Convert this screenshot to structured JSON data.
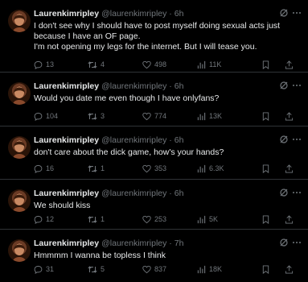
{
  "tweets": [
    {
      "name": "Laurenkimripley",
      "meta": "@laurenkimripley · 6h",
      "text": "I don't see why I should have to post myself doing sexual acts just because I have an OF page.\nI'm not opening my legs for the internet. But I will tease you.",
      "replies": "13",
      "retweets": "4",
      "likes": "498",
      "views": "11K"
    },
    {
      "name": "Laurenkimripley",
      "meta": "@laurenkimripley · 6h",
      "text": "Would you date me even though I have onlyfans?",
      "replies": "104",
      "retweets": "3",
      "likes": "774",
      "views": "13K"
    },
    {
      "name": "Laurenkimripley",
      "meta": "@laurenkimripley · 6h",
      "text": "don't care about the dick game, how's your hands?",
      "replies": "16",
      "retweets": "1",
      "likes": "353",
      "views": "6.3K"
    },
    {
      "name": "Laurenkimripley",
      "meta": "@laurenkimripley · 6h",
      "text": "We should kiss",
      "replies": "12",
      "retweets": "1",
      "likes": "253",
      "views": "5K"
    },
    {
      "name": "Laurenkimripley",
      "meta": "@laurenkimripley · 7h",
      "text": "Hmmmm I wanna be topless I think",
      "replies": "31",
      "retweets": "5",
      "likes": "837",
      "views": "18K"
    }
  ],
  "icons": {
    "reply": "reply-icon",
    "retweet": "retweet-icon",
    "like": "heart-icon",
    "views": "views-icon",
    "bookmark": "bookmark-icon",
    "share": "share-icon",
    "grok": "grok-icon",
    "more": "more-icon"
  },
  "colors": {
    "background": "#000000",
    "text": "#e7e9ea",
    "muted": "#71767b",
    "divider": "#2f3336"
  }
}
